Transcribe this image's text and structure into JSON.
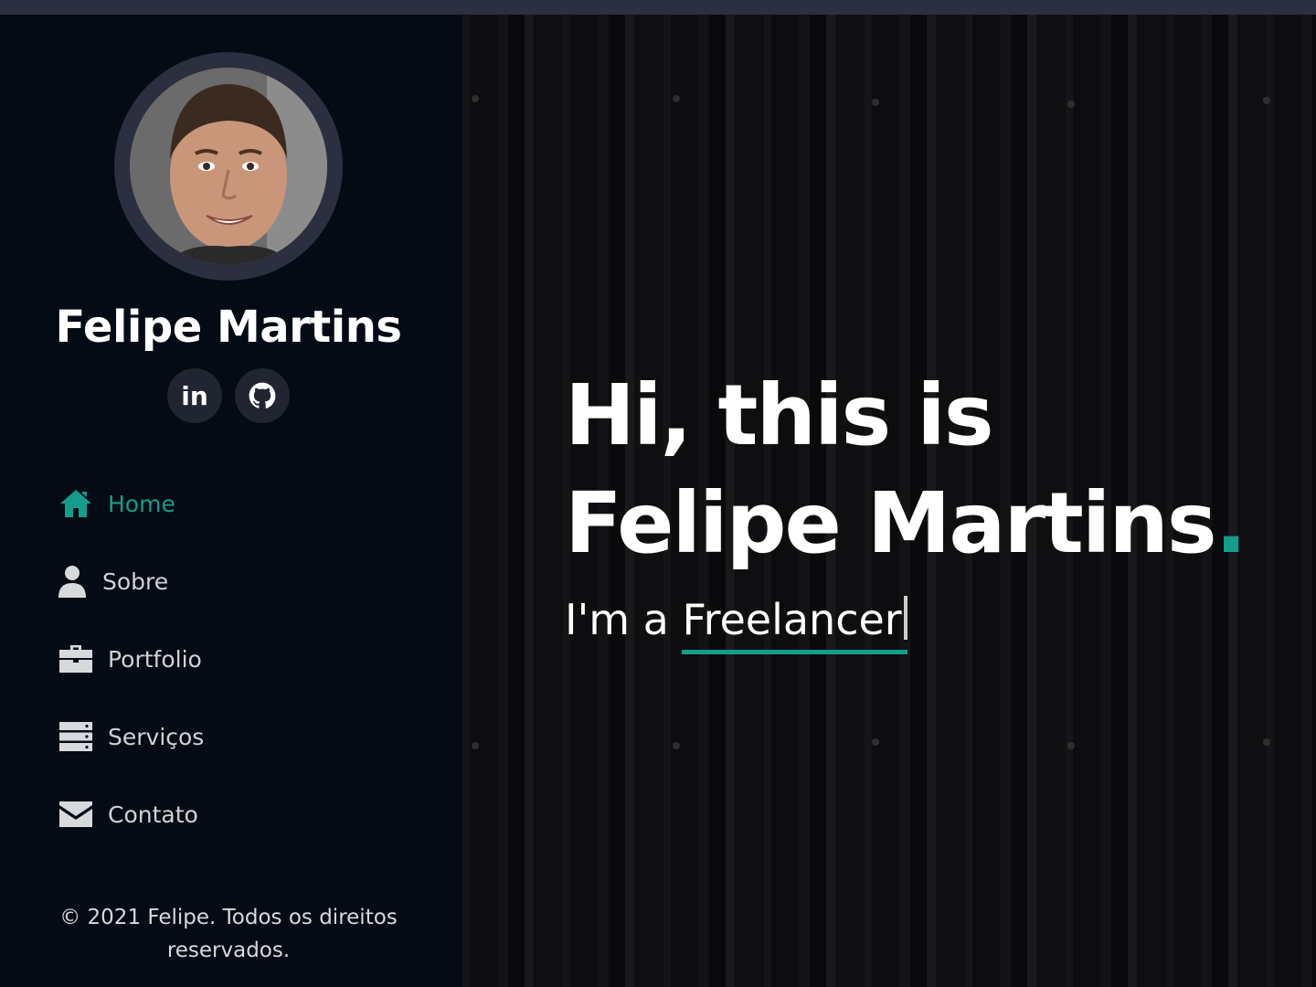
{
  "colors": {
    "accent": "#149d8a",
    "sidebar_bg": "#040b14",
    "avatar_ring": "#2c2f3f",
    "social_bg": "#212431",
    "text_muted": "#d0d2d6"
  },
  "profile": {
    "name": "Felipe Martins",
    "avatar_icon": "user-photo"
  },
  "social": {
    "linkedin_label": "in",
    "linkedin_icon": "linkedin-icon",
    "github_icon": "github-icon"
  },
  "nav": {
    "items": [
      {
        "label": "Home",
        "icon": "home-icon",
        "active": true
      },
      {
        "label": "Sobre",
        "icon": "user-icon",
        "active": false
      },
      {
        "label": "Portfolio",
        "icon": "briefcase-icon",
        "active": false
      },
      {
        "label": "Serviços",
        "icon": "server-icon",
        "active": false
      },
      {
        "label": "Contato",
        "icon": "envelope-icon",
        "active": false
      }
    ]
  },
  "footer": {
    "copyright_line1": "© 2021 Felipe. Todos os direitos",
    "copyright_line2": "reservados."
  },
  "hero": {
    "line1": "Hi, this is",
    "line2": "Felipe Martins",
    "line2_dot": ".",
    "subtitle_prefix": "I'm a ",
    "typed_word": "Freelancer"
  }
}
